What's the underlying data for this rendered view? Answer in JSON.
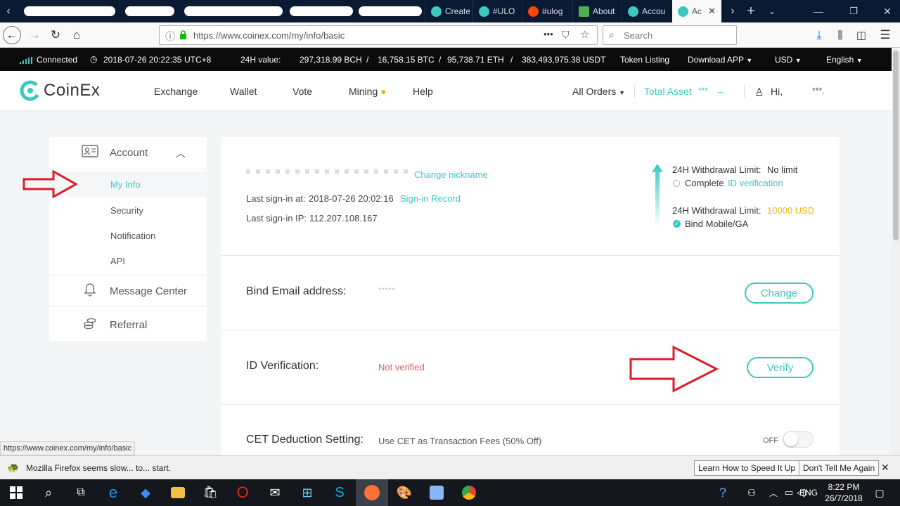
{
  "browser": {
    "tabs": [
      {
        "label": "Create",
        "color": "#3cc8c0"
      },
      {
        "label": "#ULO",
        "color": "#3cc8c0"
      },
      {
        "label": "#ulog",
        "color": "#ff4500"
      },
      {
        "label": "About",
        "color": "#4caf50"
      },
      {
        "label": "Accou",
        "color": "#3cc8c0"
      },
      {
        "label": "Ac",
        "color": "#3cc8c0",
        "active": true
      }
    ],
    "url": "https://www.coinex.com/my/info/basic",
    "search_placeholder": "Search",
    "page_actions": "•••"
  },
  "ticker": {
    "status": "Connected",
    "datetime": "2018-07-26 20:22:35",
    "timezone": "UTC+8",
    "value_label": "24H value:",
    "bch": "297,318.99 BCH",
    "btc": "16,758.15 BTC",
    "eth": "95,738.71 ETH",
    "usdt": "383,493,975.38 USDT",
    "sep": "/",
    "token_listing": "Token Listing",
    "download": "Download APP",
    "currency": "USD",
    "language": "English"
  },
  "header": {
    "brand": "CoinEx",
    "nav": [
      "Exchange",
      "Wallet",
      "Vote",
      "Mining",
      "Help"
    ],
    "all_orders": "All Orders",
    "total_asset": "Total Asset",
    "asset_mask": "***",
    "greeting": "Hi,",
    "user_mask": "***."
  },
  "sidebar": {
    "account": "Account",
    "items": [
      "My Info",
      "Security",
      "Notification",
      "API"
    ],
    "message_center": "Message Center",
    "referral": "Referral"
  },
  "info": {
    "change_nickname": "Change nickname",
    "last_signin_label": "Last sign-in at:",
    "last_signin_time": "2018-07-26 20:02:16",
    "signin_record": "Sign-in Record",
    "last_ip_label": "Last sign-in IP:",
    "last_ip": "112.207.108.167",
    "limit1_label": "24H Withdrawal Limit:",
    "limit1_value": "No limit",
    "complete": "Complete",
    "id_verification_link": "ID verification",
    "limit2_label": "24H Withdrawal Limit:",
    "limit2_value": "10000 USD",
    "bind_mobile": "Bind Mobile/GA"
  },
  "email": {
    "label": "Bind Email address:",
    "masked": "*****",
    "button": "Change"
  },
  "idv": {
    "label": "ID Verification:",
    "status": "Not verified",
    "button": "Verify"
  },
  "cet": {
    "label": "CET Deduction Setting:",
    "desc": "Use CET as Transaction Fees (50% Off)",
    "toggle": "OFF"
  },
  "status_url": "https://www.coinex.com/my/info/basic",
  "notification": {
    "message": "Mozilla Firefox seems slow... to... start.",
    "learn": "Learn How to Speed It Up",
    "dismiss": "Don't Tell Me Again"
  },
  "taskbar": {
    "lang": "ENG",
    "time": "8:22 PM",
    "date": "26/7/2018"
  },
  "colors": {
    "accent": "#3cc8c0",
    "warning": "#f0b90b",
    "error": "#e05c5c"
  }
}
